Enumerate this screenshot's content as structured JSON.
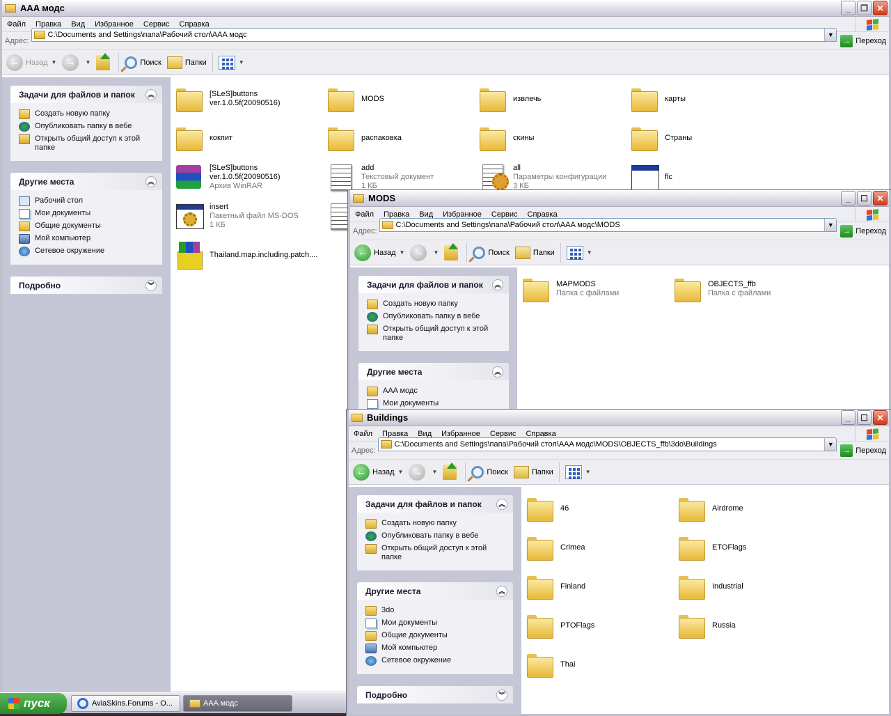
{
  "ui": {
    "menu": [
      "Файл",
      "Правка",
      "Вид",
      "Избранное",
      "Сервис",
      "Справка"
    ],
    "address_label": "Адрес:",
    "go_label": "Переход",
    "back": "Назад",
    "search": "Поиск",
    "folders": "Папки",
    "tasks_title": "Задачи для файлов и папок",
    "tasks": [
      {
        "label": "Создать новую папку",
        "icon": "new-folder-icon"
      },
      {
        "label": "Опубликовать папку в вебе",
        "icon": "publish-web-icon"
      },
      {
        "label": "Открыть общий доступ к этой папке",
        "icon": "share-folder-icon"
      }
    ],
    "other_title": "Другие места",
    "details_title": "Подробно"
  },
  "windows": [
    {
      "title": "AAA модс",
      "address": "C:\\Documents and Settings\\папа\\Рабочий стол\\AAA модс",
      "back_enabled": false,
      "other_places": [
        {
          "label": "Рабочий стол",
          "icon": "desktop-icon"
        },
        {
          "label": "Мои документы",
          "icon": "my-documents-icon"
        },
        {
          "label": "Общие документы",
          "icon": "folder-icon"
        },
        {
          "label": "Мой компьютер",
          "icon": "my-computer-icon"
        },
        {
          "label": "Сетевое окружение",
          "icon": "network-icon"
        }
      ],
      "show_details": true,
      "items": [
        {
          "name": "[SLeS]buttons ver.1.0.5f(20090516)",
          "type": "folder"
        },
        {
          "name": "MODS",
          "type": "folder"
        },
        {
          "name": "извлечь",
          "type": "folder"
        },
        {
          "name": "карты",
          "type": "folder"
        },
        {
          "name": "кокпит",
          "type": "folder"
        },
        {
          "name": "распаковка",
          "type": "folder"
        },
        {
          "name": "скины",
          "type": "folder"
        },
        {
          "name": "Страны",
          "type": "folder"
        },
        {
          "name": "[SLeS]buttons ver.1.0.5f(20090516)",
          "type": "rar",
          "desc": "Архив WinRAR"
        },
        {
          "name": "add",
          "type": "txt",
          "desc": "Текстовый документ",
          "size": "1 КБ"
        },
        {
          "name": "all",
          "type": "cfg",
          "desc": "Параметры конфигурации",
          "size": "3 КБ"
        },
        {
          "name": "flc",
          "type": "flc"
        },
        {
          "name": "insert",
          "type": "bat",
          "desc": "Пакетный файл MS-DOS",
          "size": "1 КБ"
        },
        {
          "type": "txt"
        },
        {
          "type": "none"
        },
        {
          "type": "none"
        },
        {
          "name": "Thailand.map.including.patch....",
          "type": "inst"
        }
      ]
    },
    {
      "title": "MODS",
      "address": "C:\\Documents and Settings\\папа\\Рабочий стол\\AAA модс\\MODS",
      "back_enabled": true,
      "other_places": [
        {
          "label": "AAA модс",
          "icon": "folder-icon"
        },
        {
          "label": "Мои документы",
          "icon": "my-documents-icon"
        }
      ],
      "show_details": false,
      "items": [
        {
          "name": "MAPMODS",
          "type": "folder",
          "desc": "Папка с файлами"
        },
        {
          "name": "OBJECTS_ffb",
          "type": "folder",
          "desc": "Папка с файлами"
        }
      ]
    },
    {
      "title": "Buildings",
      "address": "C:\\Documents and Settings\\папа\\Рабочий стол\\AAA модс\\MODS\\OBJECTS_ffb\\3do\\Buildings",
      "back_enabled": true,
      "other_places": [
        {
          "label": "3do",
          "icon": "folder-icon"
        },
        {
          "label": "Мои документы",
          "icon": "my-documents-icon"
        },
        {
          "label": "Общие документы",
          "icon": "folder-icon"
        },
        {
          "label": "Мой компьютер",
          "icon": "my-computer-icon"
        },
        {
          "label": "Сетевое окружение",
          "icon": "network-icon"
        }
      ],
      "show_details": true,
      "items": [
        {
          "name": "46",
          "type": "folder"
        },
        {
          "name": "Airdrome",
          "type": "folder"
        },
        {
          "name": "Crimea",
          "type": "folder"
        },
        {
          "name": "ETOFlags",
          "type": "folder"
        },
        {
          "name": "Finland",
          "type": "folder"
        },
        {
          "name": "Industrial",
          "type": "folder"
        },
        {
          "name": "PTOFlags",
          "type": "folder"
        },
        {
          "name": "Russia",
          "type": "folder"
        },
        {
          "name": "Thai",
          "type": "folder"
        }
      ]
    }
  ],
  "taskbar": {
    "start": "пуск",
    "buttons": [
      {
        "label": "AviaSkins.Forums - O...",
        "icon": "internet-explorer-icon"
      },
      {
        "label": "AAA модс",
        "icon": "folder-icon",
        "active": true
      }
    ]
  },
  "colors": {
    "pane": "#c6c7d6",
    "close": "#d03818"
  }
}
